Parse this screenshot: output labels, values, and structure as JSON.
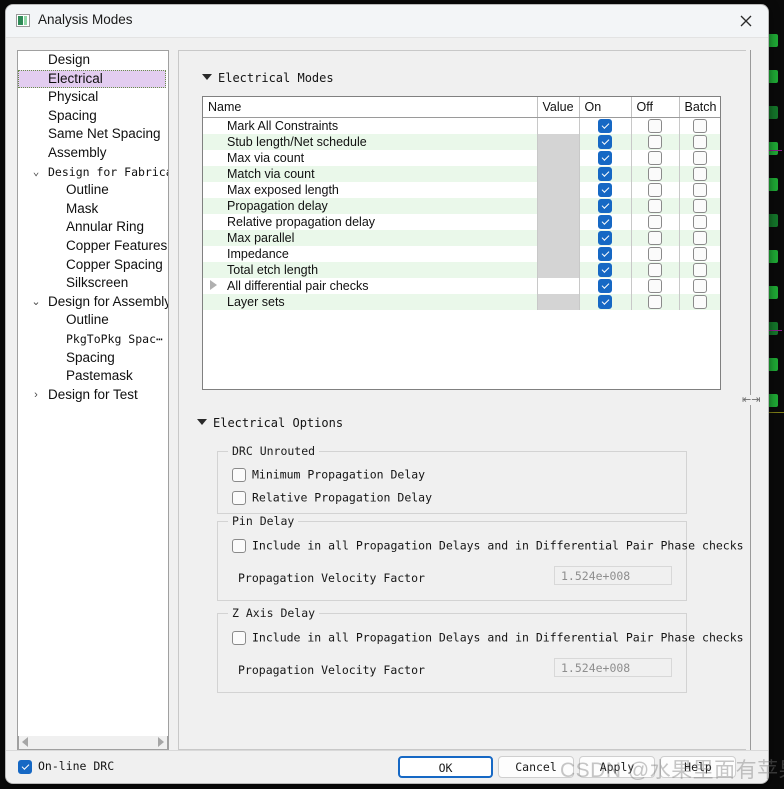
{
  "window": {
    "title": "Analysis Modes",
    "app_icon": "app-icon",
    "close_icon": "close-icon"
  },
  "sidebar": {
    "items": [
      {
        "label": "Design",
        "level": 0,
        "arrow": "",
        "mono": false,
        "selected": false
      },
      {
        "label": "Electrical",
        "level": 0,
        "arrow": "",
        "mono": false,
        "selected": true
      },
      {
        "label": "Physical",
        "level": 0,
        "arrow": "",
        "mono": false,
        "selected": false
      },
      {
        "label": "Spacing",
        "level": 0,
        "arrow": "",
        "mono": false,
        "selected": false
      },
      {
        "label": "Same Net Spacing",
        "level": 0,
        "arrow": "",
        "mono": false,
        "selected": false
      },
      {
        "label": "Assembly",
        "level": 0,
        "arrow": "",
        "mono": false,
        "selected": false
      },
      {
        "label": "Design for Fabricat⋯",
        "level": 0,
        "arrow": "v",
        "mono": true,
        "selected": false
      },
      {
        "label": "Outline",
        "level": 1,
        "arrow": "",
        "mono": false,
        "selected": false
      },
      {
        "label": "Mask",
        "level": 1,
        "arrow": "",
        "mono": false,
        "selected": false
      },
      {
        "label": "Annular Ring",
        "level": 1,
        "arrow": "",
        "mono": false,
        "selected": false
      },
      {
        "label": "Copper Features",
        "level": 1,
        "arrow": "",
        "mono": false,
        "selected": false
      },
      {
        "label": "Copper Spacing",
        "level": 1,
        "arrow": "",
        "mono": false,
        "selected": false
      },
      {
        "label": "Silkscreen",
        "level": 1,
        "arrow": "",
        "mono": false,
        "selected": false
      },
      {
        "label": "Design for Assembly",
        "level": 0,
        "arrow": "v",
        "mono": false,
        "selected": false
      },
      {
        "label": "Outline",
        "level": 1,
        "arrow": "",
        "mono": false,
        "selected": false
      },
      {
        "label": "PkgToPkg Spac⋯",
        "level": 1,
        "arrow": "",
        "mono": true,
        "selected": false
      },
      {
        "label": "Spacing",
        "level": 1,
        "arrow": "",
        "mono": false,
        "selected": false
      },
      {
        "label": "Pastemask",
        "level": 1,
        "arrow": "",
        "mono": false,
        "selected": false
      },
      {
        "label": "Design for Test",
        "level": 0,
        "arrow": ">",
        "mono": false,
        "selected": false
      }
    ],
    "hscroll": {
      "left_icon": "scroll-left-arrow-icon",
      "right_icon": "scroll-right-arrow-icon"
    }
  },
  "modes_section": {
    "title": "Electrical Modes",
    "columns": [
      "Name",
      "Value",
      "On",
      "Off",
      "Batch"
    ],
    "rows": [
      {
        "name": "Mark All Constraints",
        "value": "",
        "value_gray": false,
        "on": true,
        "off": false,
        "batch": false,
        "alt": false,
        "expandable": false
      },
      {
        "name": "Stub length/Net schedule",
        "value": "",
        "value_gray": true,
        "on": true,
        "off": false,
        "batch": false,
        "alt": true,
        "expandable": false
      },
      {
        "name": "Max via count",
        "value": "",
        "value_gray": true,
        "on": true,
        "off": false,
        "batch": false,
        "alt": false,
        "expandable": false
      },
      {
        "name": "Match via count",
        "value": "",
        "value_gray": true,
        "on": true,
        "off": false,
        "batch": false,
        "alt": true,
        "expandable": false
      },
      {
        "name": "Max exposed length",
        "value": "",
        "value_gray": true,
        "on": true,
        "off": false,
        "batch": false,
        "alt": false,
        "expandable": false
      },
      {
        "name": "Propagation delay",
        "value": "",
        "value_gray": true,
        "on": true,
        "off": false,
        "batch": false,
        "alt": true,
        "expandable": false
      },
      {
        "name": "Relative propagation delay",
        "value": "",
        "value_gray": true,
        "on": true,
        "off": false,
        "batch": false,
        "alt": false,
        "expandable": false
      },
      {
        "name": "Max parallel",
        "value": "",
        "value_gray": true,
        "on": true,
        "off": false,
        "batch": false,
        "alt": true,
        "expandable": false
      },
      {
        "name": "Impedance",
        "value": "",
        "value_gray": true,
        "on": true,
        "off": false,
        "batch": false,
        "alt": false,
        "expandable": false
      },
      {
        "name": "Total etch length",
        "value": "",
        "value_gray": true,
        "on": true,
        "off": false,
        "batch": false,
        "alt": true,
        "expandable": false
      },
      {
        "name": "All differential pair checks",
        "value": "",
        "value_gray": false,
        "on": true,
        "off": false,
        "batch": false,
        "alt": false,
        "expandable": true
      },
      {
        "name": "Layer sets",
        "value": "",
        "value_gray": true,
        "on": true,
        "off": false,
        "batch": false,
        "alt": true,
        "expandable": false
      }
    ]
  },
  "options_section": {
    "title": "Electrical Options",
    "drc_unrouted": {
      "legend": "DRC Unrouted",
      "checkboxes": [
        {
          "label": "Minimum Propagation Delay",
          "checked": false
        },
        {
          "label": "Relative Propagation Delay",
          "checked": false
        }
      ]
    },
    "pin_delay": {
      "legend": "Pin Delay",
      "include_label": "Include in all Propagation Delays and in Differential Pair Phase checks",
      "include_checked": false,
      "velocity_label": "Propagation Velocity Factor",
      "velocity_value": "1.524e+008"
    },
    "z_axis_delay": {
      "legend": "Z Axis Delay",
      "include_label": "Include in all Propagation Delays and in Differential Pair Phase checks",
      "include_checked": false,
      "velocity_label": "Propagation Velocity Factor",
      "velocity_value": "1.524e+008"
    }
  },
  "footer": {
    "online_drc": {
      "label": "On-line DRC",
      "checked": true
    },
    "buttons": [
      {
        "label": "OK",
        "primary": true
      },
      {
        "label": "Cancel",
        "primary": false
      },
      {
        "label": "Apply",
        "primary": false
      },
      {
        "label": "Help",
        "primary": false
      }
    ]
  },
  "watermark": {
    "text": "CSDN @水果里面有苹果"
  },
  "colors": {
    "accent": "#1668c4",
    "selection": "#e3cdf0",
    "alt_row": "#eaf8ea",
    "value_gray": "#d4d4d4"
  }
}
